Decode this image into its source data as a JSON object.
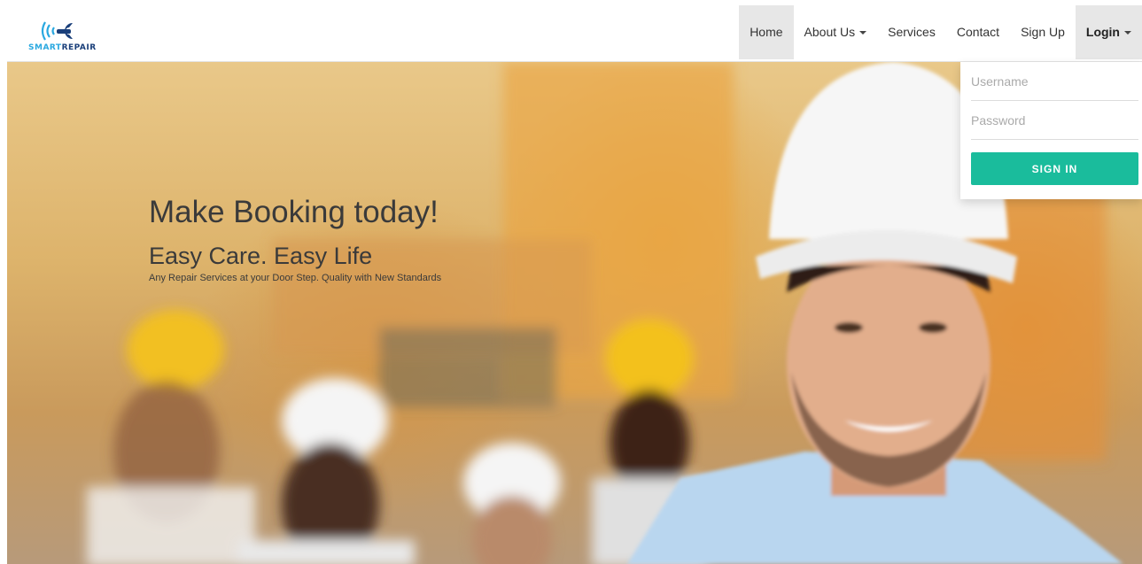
{
  "brand": {
    "name_part1": "SMART",
    "name_part2": "REPAIR",
    "logo_icon": "wireless-wrench-icon"
  },
  "nav": {
    "items": [
      {
        "label": "Home",
        "active": true
      },
      {
        "label": "About Us",
        "has_dropdown": true
      },
      {
        "label": "Services"
      },
      {
        "label": "Contact"
      },
      {
        "label": "Sign Up"
      },
      {
        "label": "Login",
        "has_dropdown": true,
        "open": true
      }
    ]
  },
  "hero": {
    "title": "Make Booking today!",
    "subtitle": "Easy Care. Easy Life",
    "description": "Any Repair Services at your Door Step. Quality with New Standards"
  },
  "login": {
    "username_placeholder": "Username",
    "password_placeholder": "Password",
    "signin_label": "SIGN IN"
  },
  "colors": {
    "accent": "#1abc9c",
    "brand_light": "#29a8e0",
    "brand_dark": "#1a3f7a",
    "nav_active": "#e7e7e7"
  }
}
